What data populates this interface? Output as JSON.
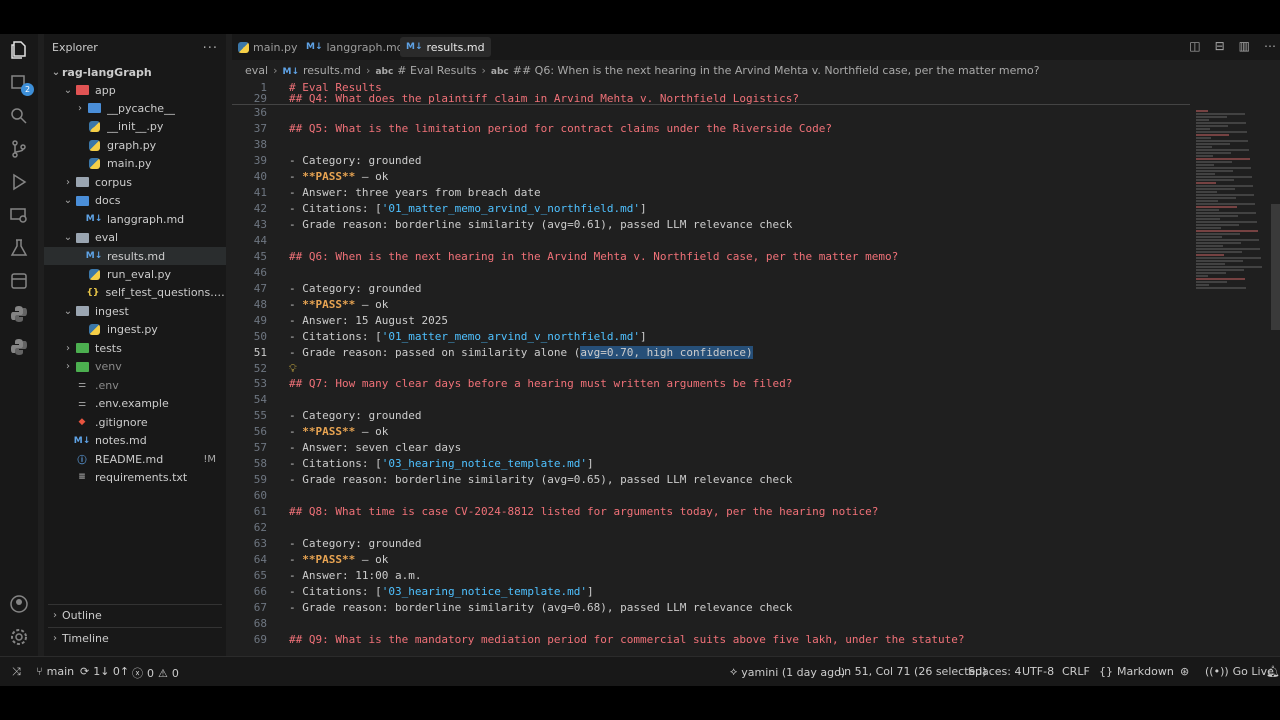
{
  "sidebar": {
    "title": "Explorer",
    "more": "...",
    "root": "rag-langGraph",
    "items": [
      {
        "label": "app",
        "depth": 1,
        "type": "folder",
        "open": true,
        "color": "#e05353"
      },
      {
        "label": "__pycache__",
        "depth": 2,
        "type": "folder",
        "open": false,
        "color": "#4a8ed8"
      },
      {
        "label": "__init__.py",
        "depth": 2,
        "type": "py"
      },
      {
        "label": "graph.py",
        "depth": 2,
        "type": "py"
      },
      {
        "label": "main.py",
        "depth": 2,
        "type": "py"
      },
      {
        "label": "corpus",
        "depth": 1,
        "type": "folder",
        "open": false,
        "color": "#9aa5b1"
      },
      {
        "label": "docs",
        "depth": 1,
        "type": "folder",
        "open": true,
        "color": "#4a8ed8"
      },
      {
        "label": "langgraph.md",
        "depth": 2,
        "type": "md"
      },
      {
        "label": "eval",
        "depth": 1,
        "type": "folder",
        "open": true,
        "color": "#9aa5b1"
      },
      {
        "label": "results.md",
        "depth": 2,
        "type": "md",
        "selected": true
      },
      {
        "label": "run_eval.py",
        "depth": 2,
        "type": "py"
      },
      {
        "label": "self_test_questions.js...",
        "depth": 2,
        "type": "json"
      },
      {
        "label": "ingest",
        "depth": 1,
        "type": "folder",
        "open": true,
        "color": "#9aa5b1"
      },
      {
        "label": "ingest.py",
        "depth": 2,
        "type": "py"
      },
      {
        "label": "tests",
        "depth": 1,
        "type": "folder",
        "open": false,
        "color": "#4caf50"
      },
      {
        "label": "venv",
        "depth": 1,
        "type": "folder",
        "open": false,
        "color": "#4caf50",
        "dim": true
      },
      {
        "label": ".env",
        "depth": 1,
        "type": "env",
        "dim": true
      },
      {
        "label": ".env.example",
        "depth": 1,
        "type": "env"
      },
      {
        "label": ".gitignore",
        "depth": 1,
        "type": "git"
      },
      {
        "label": "notes.md",
        "depth": 1,
        "type": "md"
      },
      {
        "label": "README.md",
        "depth": 1,
        "type": "info",
        "git": "!M"
      },
      {
        "label": "requirements.txt",
        "depth": 1,
        "type": "txt"
      }
    ],
    "outline_label": "Outline",
    "timeline_label": "Timeline"
  },
  "badge": "2",
  "tabs": [
    {
      "label": "main.py",
      "type": "py",
      "active": false
    },
    {
      "label": "langgraph.md",
      "type": "md",
      "active": false
    },
    {
      "label": "results.md",
      "type": "md",
      "active": true
    }
  ],
  "breadcrumb": [
    "eval",
    "results.md",
    "# Eval Results",
    "## Q6: When is the next hearing in the Arvind Mehta v. Northfield case, per the matter memo?"
  ],
  "sticky": [
    {
      "ln": "1",
      "text": "# Eval Results"
    },
    {
      "ln": "29",
      "text": "## Q4: What does the plaintiff claim in Arvind Mehta v. Northfield Logistics?"
    }
  ],
  "lines": [
    {
      "ln": "36",
      "parts": []
    },
    {
      "ln": "37",
      "parts": [
        {
          "t": "## Q5: What is the limitation period for contract claims under the Riverside Code?",
          "c": "h"
        }
      ]
    },
    {
      "ln": "38",
      "parts": []
    },
    {
      "ln": "39",
      "parts": [
        {
          "t": "- Category: grounded",
          "c": ""
        }
      ]
    },
    {
      "ln": "40",
      "parts": [
        {
          "t": "- ",
          "c": ""
        },
        {
          "t": "**PASS**",
          "c": "y"
        },
        {
          "t": " — ok",
          "c": ""
        }
      ]
    },
    {
      "ln": "41",
      "parts": [
        {
          "t": "- Answer: three years from breach date",
          "c": ""
        }
      ]
    },
    {
      "ln": "42",
      "parts": [
        {
          "t": "- Citations: [",
          "c": ""
        },
        {
          "t": "'01_matter_memo_arvind_v_northfield.md'",
          "c": "s"
        },
        {
          "t": "]",
          "c": ""
        }
      ]
    },
    {
      "ln": "43",
      "parts": [
        {
          "t": "- Grade reason: borderline similarity (avg=0.61), passed LLM relevance check",
          "c": ""
        }
      ]
    },
    {
      "ln": "44",
      "parts": []
    },
    {
      "ln": "45",
      "parts": [
        {
          "t": "## Q6: When is the next hearing in the Arvind Mehta v. Northfield case, per the matter memo?",
          "c": "h"
        }
      ]
    },
    {
      "ln": "46",
      "parts": []
    },
    {
      "ln": "47",
      "parts": [
        {
          "t": "- Category: grounded",
          "c": ""
        }
      ]
    },
    {
      "ln": "48",
      "parts": [
        {
          "t": "- ",
          "c": ""
        },
        {
          "t": "**PASS**",
          "c": "y"
        },
        {
          "t": " — ok",
          "c": ""
        }
      ]
    },
    {
      "ln": "49",
      "parts": [
        {
          "t": "- Answer: 15 August 2025",
          "c": ""
        }
      ]
    },
    {
      "ln": "50",
      "parts": [
        {
          "t": "- Citations: [",
          "c": ""
        },
        {
          "t": "'01_matter_memo_arvind_v_northfield.md'",
          "c": "s"
        },
        {
          "t": "]",
          "c": ""
        }
      ]
    },
    {
      "ln": "51",
      "parts": [
        {
          "t": "- Grade reason: passed on similarity alone (",
          "c": ""
        },
        {
          "t": "avg=0.70, high confidence)",
          "c": "sel"
        }
      ],
      "cur": true
    },
    {
      "ln": "52",
      "parts": [],
      "bulb": true
    },
    {
      "ln": "53",
      "parts": [
        {
          "t": "## Q7: How many clear days before a hearing must written arguments be filed?",
          "c": "h"
        }
      ]
    },
    {
      "ln": "54",
      "parts": []
    },
    {
      "ln": "55",
      "parts": [
        {
          "t": "- Category: grounded",
          "c": ""
        }
      ]
    },
    {
      "ln": "56",
      "parts": [
        {
          "t": "- ",
          "c": ""
        },
        {
          "t": "**PASS**",
          "c": "y"
        },
        {
          "t": " — ok",
          "c": ""
        }
      ]
    },
    {
      "ln": "57",
      "parts": [
        {
          "t": "- Answer: seven clear days",
          "c": ""
        }
      ]
    },
    {
      "ln": "58",
      "parts": [
        {
          "t": "- Citations: [",
          "c": ""
        },
        {
          "t": "'03_hearing_notice_template.md'",
          "c": "s"
        },
        {
          "t": "]",
          "c": ""
        }
      ]
    },
    {
      "ln": "59",
      "parts": [
        {
          "t": "- Grade reason: borderline similarity (avg=0.65), passed LLM relevance check",
          "c": ""
        }
      ]
    },
    {
      "ln": "60",
      "parts": []
    },
    {
      "ln": "61",
      "parts": [
        {
          "t": "## Q8: What time is case CV-2024-8812 listed for arguments today, per the hearing notice?",
          "c": "h"
        }
      ]
    },
    {
      "ln": "62",
      "parts": []
    },
    {
      "ln": "63",
      "parts": [
        {
          "t": "- Category: grounded",
          "c": ""
        }
      ]
    },
    {
      "ln": "64",
      "parts": [
        {
          "t": "- ",
          "c": ""
        },
        {
          "t": "**PASS**",
          "c": "y"
        },
        {
          "t": " — ok",
          "c": ""
        }
      ]
    },
    {
      "ln": "65",
      "parts": [
        {
          "t": "- Answer: 11:00 a.m.",
          "c": ""
        }
      ]
    },
    {
      "ln": "66",
      "parts": [
        {
          "t": "- Citations: [",
          "c": ""
        },
        {
          "t": "'03_hearing_notice_template.md'",
          "c": "s"
        },
        {
          "t": "]",
          "c": ""
        }
      ]
    },
    {
      "ln": "67",
      "parts": [
        {
          "t": "- Grade reason: borderline similarity (avg=0.68), passed LLM relevance check",
          "c": ""
        }
      ]
    },
    {
      "ln": "68",
      "parts": []
    },
    {
      "ln": "69",
      "parts": [
        {
          "t": "## Q9: What is the mandatory mediation period for commercial suits above five lakh, under the statute?",
          "c": "h"
        }
      ]
    }
  ],
  "status": {
    "branch": "main",
    "sync": "1↓ 0↑",
    "errors": "0",
    "warnings": "0",
    "blame": "yamini (1 day ago)",
    "cursor": "Ln 51, Col 71 (26 selected)",
    "spaces": "Spaces: 4",
    "encoding": "UTF-8",
    "eol": "CRLF",
    "language": "Markdown",
    "golive": "Go Live"
  }
}
